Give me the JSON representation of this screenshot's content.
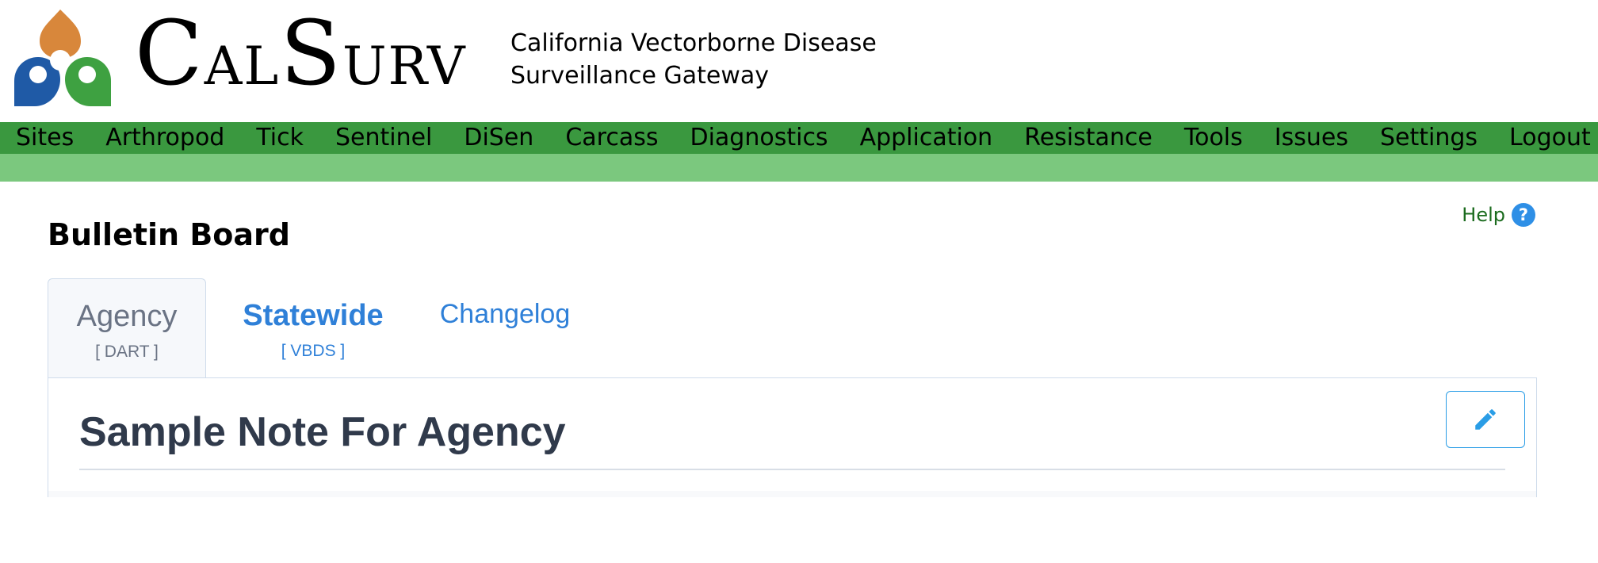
{
  "header": {
    "logo_text_first": "C",
    "logo_text_al": "AL",
    "logo_text_s": "S",
    "logo_text_urv": "URV",
    "tagline_line1": "California Vectorborne Disease",
    "tagline_line2": "Surveillance Gateway"
  },
  "nav": {
    "items": [
      "Sites",
      "Arthropod",
      "Tick",
      "Sentinel",
      "DiSen",
      "Carcass",
      "Diagnostics",
      "Application",
      "Resistance",
      "Tools",
      "Issues",
      "Settings",
      "Logout"
    ]
  },
  "page": {
    "title": "Bulletin Board",
    "help_label": "Help",
    "help_icon_glyph": "?"
  },
  "tabs": [
    {
      "label": "Agency",
      "sub": "[ DART ]"
    },
    {
      "label": "Statewide",
      "sub": "[ VBDS ]"
    },
    {
      "label": "Changelog"
    }
  ],
  "note": {
    "title": "Sample Note For Agency"
  },
  "icons": {
    "logo": "calsurv-logo-icon",
    "help": "help-circle-icon",
    "edit": "pencil-icon"
  },
  "colors": {
    "nav_bg": "#3a983f",
    "subbar_bg": "#7bc87e",
    "help_text": "#1b6b1e",
    "link_blue": "#2f80d8",
    "edit_border": "#2a9de6",
    "logo_orange": "#d8873b",
    "logo_blue": "#1f5aa6",
    "logo_green": "#3ea141"
  }
}
